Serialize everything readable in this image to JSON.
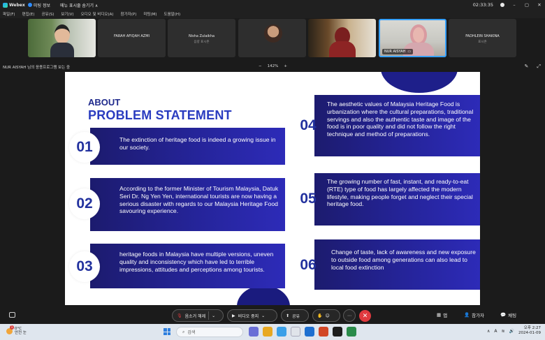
{
  "titlebar": {
    "app_name": "Webex",
    "meeting_info": "미팅 정보",
    "hide_menu": "메뉴 표시줄 숨기기 ∧",
    "timer": "02:33:35"
  },
  "menu": [
    "파일(F)",
    "편집(E)",
    "공유(S)",
    "보기(V)",
    "오디오 및 비디오(A)",
    "참가자(P)",
    "미팅(M)",
    "도움말(H)"
  ],
  "participants": [
    {
      "name": "",
      "sub": "",
      "kind": "video"
    },
    {
      "name": "FARAH AFIQAH AZMI",
      "sub": "",
      "kind": "name"
    },
    {
      "name": "Nisha Zulaikha",
      "sub": "음량 표시존",
      "kind": "name"
    },
    {
      "name": "",
      "sub": "",
      "kind": "avatar"
    },
    {
      "name": "",
      "sub": "",
      "kind": "video"
    },
    {
      "name": "NUR AISYAH",
      "sub": "",
      "kind": "video-active"
    },
    {
      "name": "FADHLEIN SHAKINA",
      "sub": "표시존",
      "kind": "name"
    }
  ],
  "share": {
    "viewing": "NUR AISYAH 님의 응용프로그램 보는 중",
    "zoom_minus": "−",
    "zoom": "142%",
    "zoom_plus": "+"
  },
  "slide": {
    "about": "ABOUT",
    "title": "PROBLEM STATEMENT",
    "items": [
      {
        "num": "01",
        "text": "The extinction of heritage food is indeed a growing issue in our society."
      },
      {
        "num": "02",
        "text": "According to the former Minister of Tourism Malaysia, Datuk Seri Dr. Ng Yen Yen, international tourists are now having a serious disaster with regards to our Malaysia Heritage Food savouring experience."
      },
      {
        "num": "03",
        "text": "heritage foods in Malaysia have multiple versions, uneven quality and inconsistency which have led to terrible impressions, attitudes and perceptions among tourists."
      },
      {
        "num": "04",
        "text": "The aesthetic values of Malaysia Heritage Food is urbanization where the cultural preparations, traditional servings and also the authentic taste and image of the food is in poor quality and did not follow the right technique and method of preparations."
      },
      {
        "num": "05",
        "text": "The growing number of fast, instant, and ready-to-eat (RTE) type of food has largely affected the modern lifestyle, making people forget and neglect their special heritage food."
      },
      {
        "num": "06",
        "text": "Change of taste, lack of awareness and new exposure to outside food among generations can also lead to local food extinction"
      }
    ]
  },
  "controls": {
    "mute": "음소거 해제",
    "video": "비디오 중지",
    "share": "공유",
    "leave": "✕",
    "apps": "앱",
    "participants": "참가자",
    "chat": "채팅"
  },
  "taskbar": {
    "weather_temp": "0°C",
    "weather_desc": "안전 눈",
    "search_placeholder": "검색",
    "time": "오후 2:27",
    "date": "2024-01-09",
    "badge": "1"
  }
}
